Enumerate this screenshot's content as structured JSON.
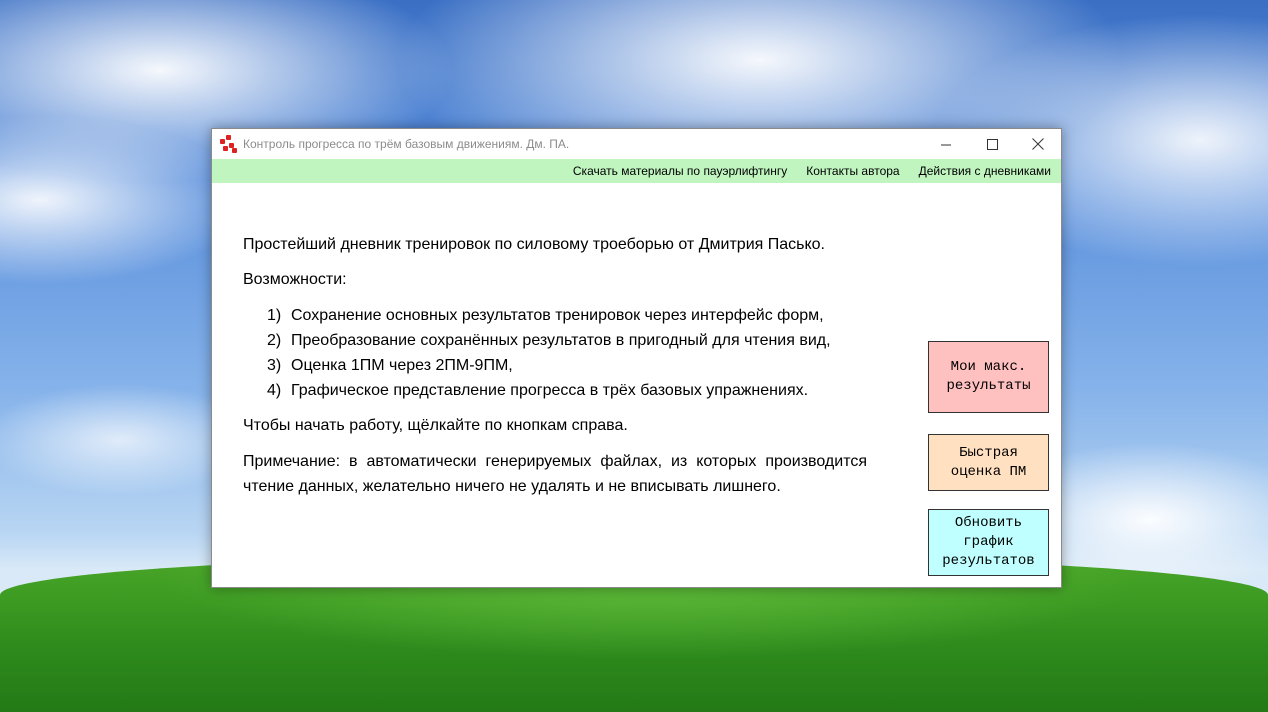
{
  "window": {
    "title": "Контроль прогресса по трём базовым движениям. Дм. ПА.",
    "minimize_glyph": "—",
    "maximize_glyph": "☐",
    "close_glyph": "✕"
  },
  "menu": {
    "items": [
      {
        "label": "Скачать материалы по пауэрлифтингу"
      },
      {
        "label": "Контакты автора"
      },
      {
        "label": "Действия с дневниками"
      }
    ]
  },
  "content": {
    "intro": "Простейший дневник тренировок по силовому троеборью от Дмитрия Пасько.",
    "features_heading": "Возможности:",
    "features": [
      {
        "num": "1)",
        "text": "Сохранение основных результатов тренировок через интерфейс форм,"
      },
      {
        "num": "2)",
        "text": "Преобразование сохранённых результатов в пригодный для чтения вид,"
      },
      {
        "num": "3)",
        "text": "Оценка 1ПМ через 2ПМ-9ПМ,"
      },
      {
        "num": "4)",
        "text": "Графическое представление прогресса в трёх базовых упражнениях."
      }
    ],
    "start_hint": "Чтобы начать работу, щёлкайте по кнопкам справа.",
    "note": "Примечание: в автоматически генерируемых файлах, из которых производится чтение данных, желательно ничего не удалять и не вписывать лишнего."
  },
  "buttons": {
    "max_results": "Мои макс.\nрезультаты",
    "quick_estimate": "Быстрая\nоценка ПМ",
    "update_graph": "Обновить\nграфик\nрезультатов"
  },
  "colors": {
    "menubar": "#c0f5c0",
    "max_results_bg": "#ffc0c0",
    "quick_estimate_bg": "#ffe0c0",
    "update_graph_bg": "#c0ffff"
  }
}
